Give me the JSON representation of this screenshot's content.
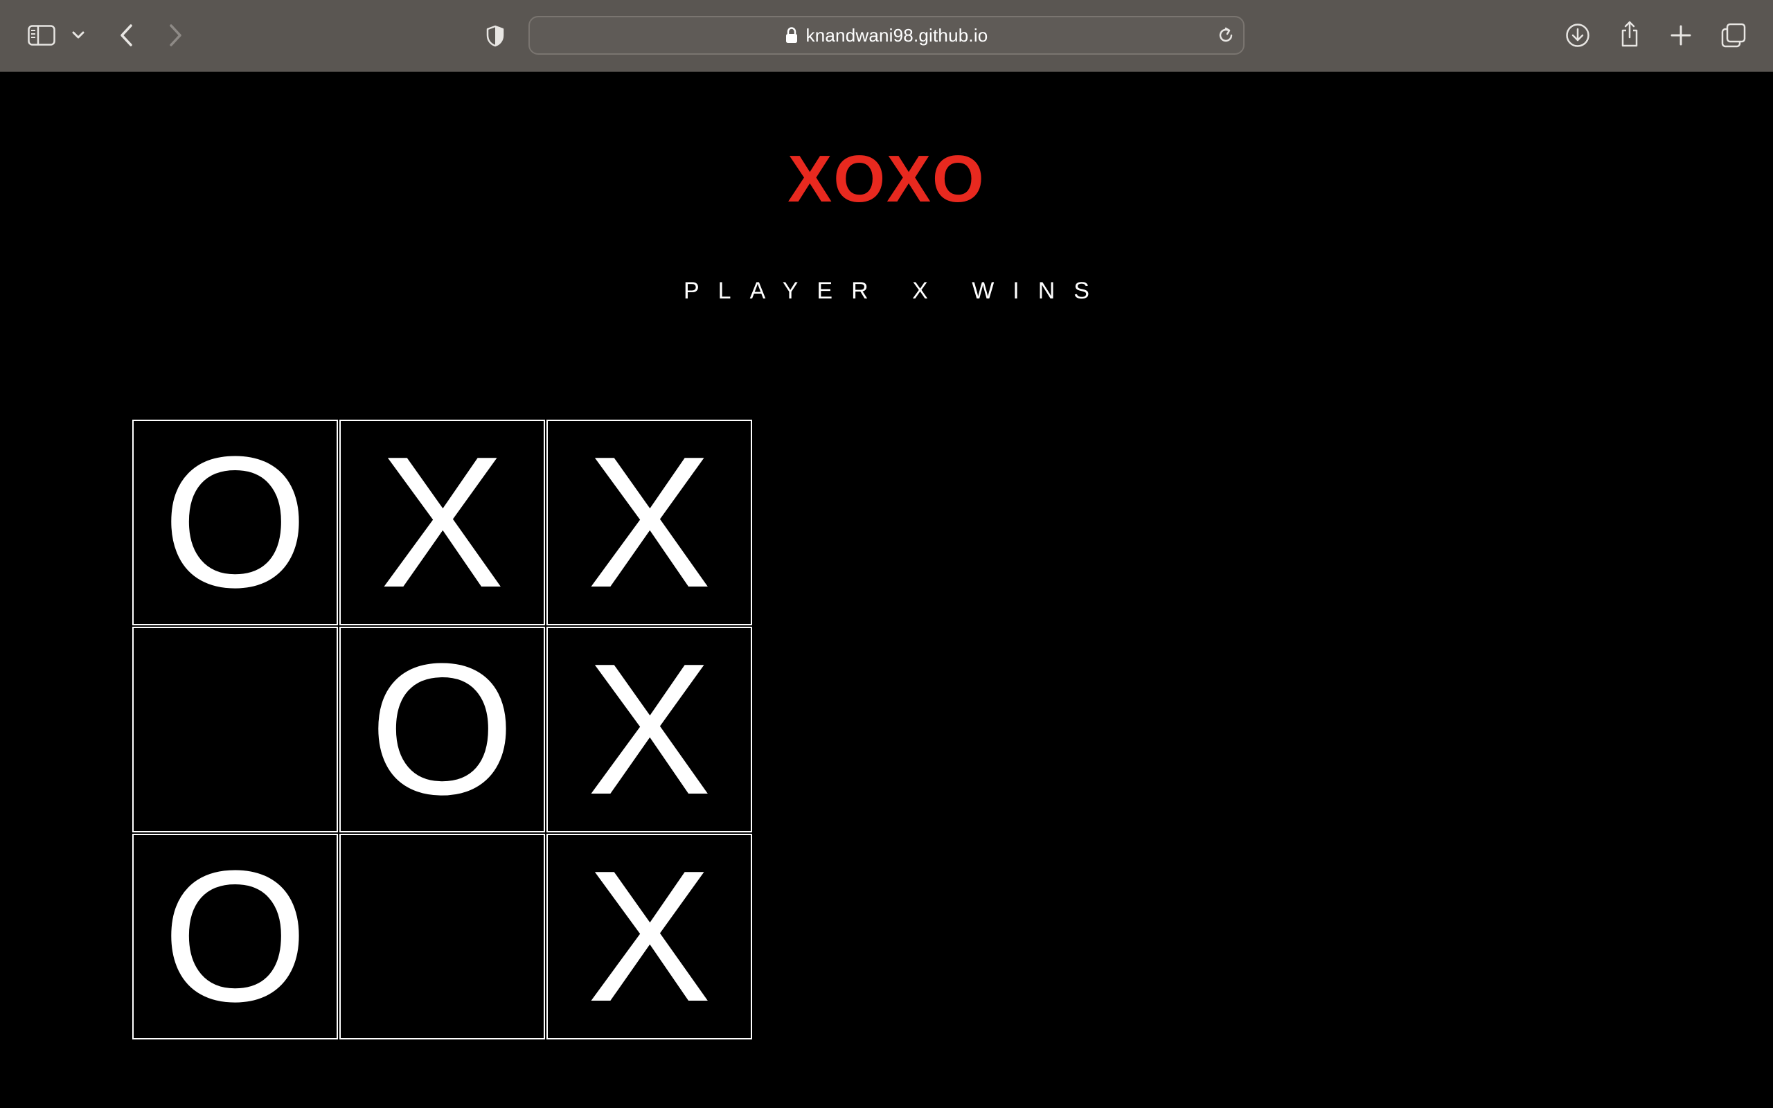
{
  "browser": {
    "url": "knandwani98.github.io",
    "icons": {
      "sidebar": "sidebar-icon",
      "sidebar_menu": "chevron-down-icon",
      "back": "back-arrow-icon",
      "forward": "forward-arrow-icon",
      "privacy": "shield-icon",
      "lock": "lock-icon",
      "reload": "reload-icon",
      "downloads": "download-icon",
      "share": "share-icon",
      "new_tab": "plus-icon",
      "tabs_overview": "tabs-overview-icon"
    }
  },
  "game": {
    "title": "XOXO",
    "status": "PLAYER X WINS",
    "board": [
      [
        "O",
        "X",
        "X"
      ],
      [
        "",
        "O",
        "X"
      ],
      [
        "O",
        "",
        "X"
      ]
    ]
  },
  "colors": {
    "title": "#e8291f",
    "background": "#000000",
    "toolbar": "#5a5652",
    "grid_lines": "#ffffff"
  }
}
